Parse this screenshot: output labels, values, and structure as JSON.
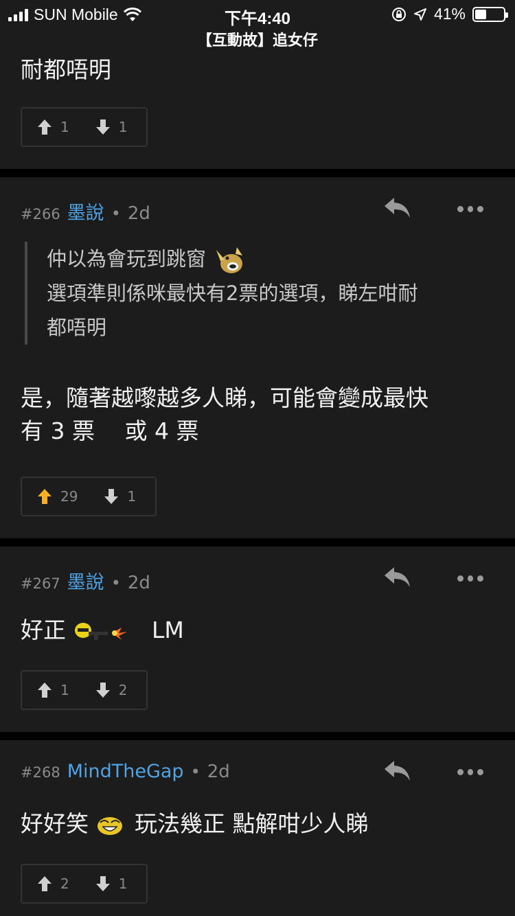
{
  "status": {
    "carrier": "SUN Mobile",
    "time": "下午4:40",
    "battery": "41%",
    "battery_level": 0.41
  },
  "thread_title": "【互動故】追女仔",
  "prev_post": {
    "body": "耐都唔明",
    "up": "1",
    "down": "1"
  },
  "posts": [
    {
      "floor": "#266",
      "user": "墨說",
      "dot": "•",
      "age": "2d",
      "quote_line1": "仲以為會玩到跳窗",
      "quote_line2": "選項準則係咪最快有2票的選項，睇左咁耐",
      "quote_line3": "都唔明",
      "body_line1": "是，隨著越嚟越多人睇，可能會變成最快",
      "body_line2": "有 3 票　 或 4 票",
      "up": "29",
      "down": "1",
      "upvoted": true
    },
    {
      "floor": "#267",
      "user": "墨說",
      "dot": "•",
      "age": "2d",
      "body_prefix": "好正",
      "body_suffix": "LM",
      "up": "1",
      "down": "2"
    },
    {
      "floor": "#268",
      "user": "MindTheGap",
      "dot": "•",
      "age": "2d",
      "body_prefix": "好好笑",
      "body_suffix": "玩法幾正 點解咁少人睇",
      "up": "2",
      "down": "1"
    }
  ],
  "colors": {
    "background": "#1c1c1c",
    "username": "#4ea4e6",
    "upvote_active": "#f5b021",
    "muted": "#8a8a8a"
  },
  "icons": [
    "signal-icon",
    "wifi-icon",
    "orientation-lock-icon",
    "location-icon",
    "battery-icon",
    "reply-icon",
    "more-icon",
    "upvote-icon",
    "downvote-icon"
  ]
}
